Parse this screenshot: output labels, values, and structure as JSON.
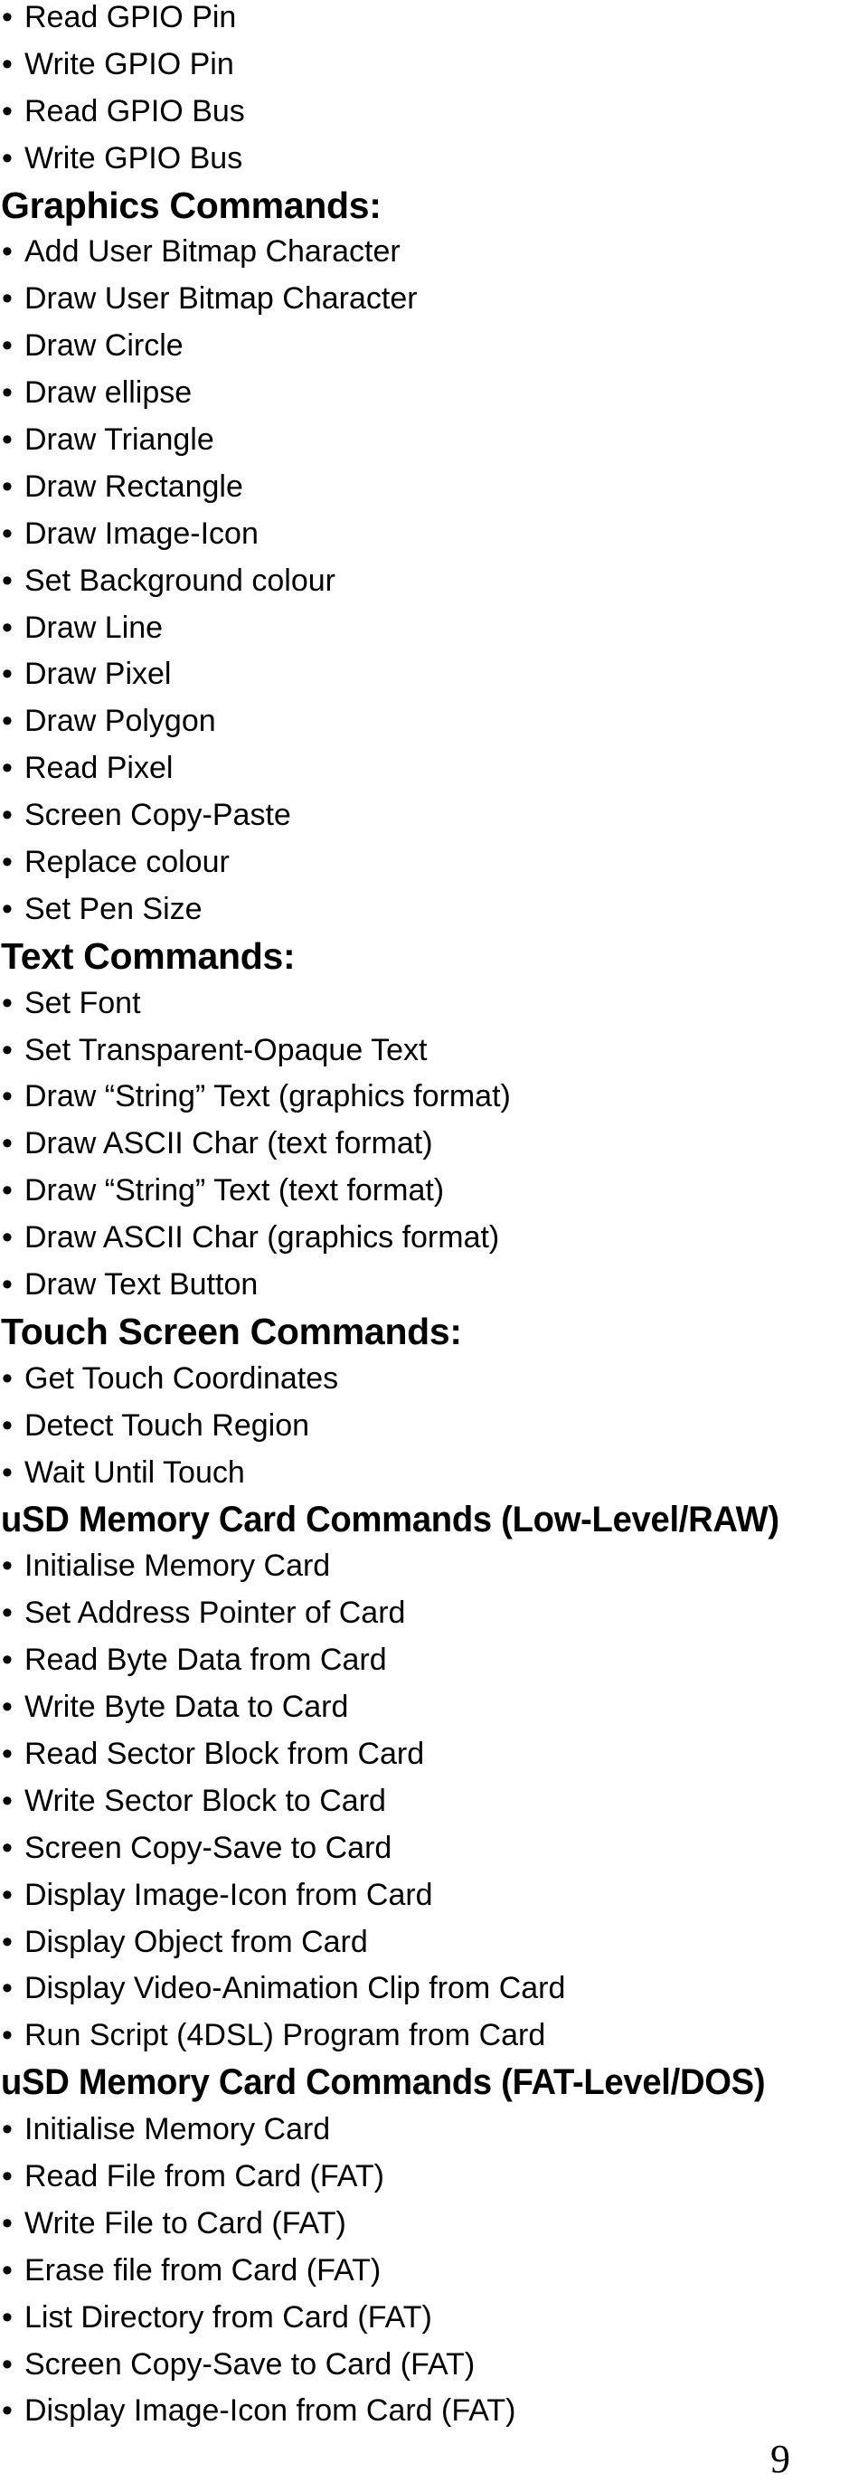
{
  "page_number": "9",
  "sections": [
    {
      "heading": null,
      "items": [
        "Read GPIO Pin",
        "Write GPIO Pin",
        "Read GPIO Bus",
        "Write GPIO Bus"
      ]
    },
    {
      "heading": "Graphics Commands:",
      "items": [
        "Add User Bitmap Character",
        "Draw User Bitmap Character",
        "Draw Circle",
        "Draw ellipse",
        "Draw Triangle",
        "Draw Rectangle",
        "Draw Image-Icon",
        "Set Background colour",
        "Draw Line",
        "Draw Pixel",
        "Draw Polygon",
        "Read Pixel",
        "Screen Copy-Paste",
        "Replace colour",
        "Set Pen Size"
      ]
    },
    {
      "heading": "Text Commands:",
      "items": [
        "Set Font",
        "Set Transparent-Opaque Text",
        "Draw “String” Text (graphics format)",
        "Draw ASCII Char (text format)",
        "Draw “String” Text (text format)",
        "Draw ASCII Char (graphics format)",
        "Draw Text Button"
      ]
    },
    {
      "heading": "Touch Screen Commands:",
      "items": [
        "Get Touch Coordinates",
        "Detect Touch Region",
        "Wait Until Touch"
      ]
    },
    {
      "heading": "uSD Memory Card Commands (Low-Level/RAW)",
      "items": [
        "Initialise Memory Card",
        "Set Address Pointer of Card",
        "Read Byte Data from Card",
        "Write Byte Data to Card",
        "Read Sector Block from Card",
        "Write Sector Block to Card",
        "Screen Copy-Save to Card",
        "Display Image-Icon from Card",
        "Display Object from Card",
        "Display Video-Animation Clip from Card",
        "Run Script (4DSL) Program from Card"
      ]
    },
    {
      "heading": "uSD Memory Card Commands (FAT-Level/DOS)",
      "items": [
        "Initialise Memory Card",
        "Read File from Card (FAT)",
        "Write File to Card (FAT)",
        "Erase file from Card (FAT)",
        "List Directory from Card (FAT)",
        "Screen Copy-Save to Card (FAT)",
        "Display Image-Icon from Card (FAT)"
      ]
    }
  ],
  "bullet_glyph": "•"
}
